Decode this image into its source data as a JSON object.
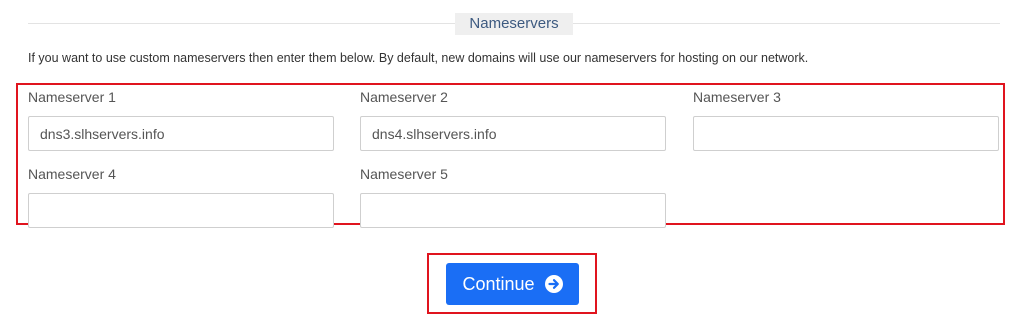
{
  "section": {
    "title": "Nameservers",
    "intro": "If you want to use custom nameservers then enter them below. By default, new domains will use our nameservers for hosting on our network."
  },
  "nameservers": [
    {
      "label": "Nameserver 1",
      "value": "dns3.slhservers.info",
      "placeholder": ""
    },
    {
      "label": "Nameserver 2",
      "value": "dns4.slhservers.info",
      "placeholder": ""
    },
    {
      "label": "Nameserver 3",
      "value": "",
      "placeholder": ""
    },
    {
      "label": "Nameserver 4",
      "value": "",
      "placeholder": ""
    },
    {
      "label": "Nameserver 5",
      "value": "",
      "placeholder": ""
    }
  ],
  "actions": {
    "continue_label": "Continue",
    "continue_icon": "arrow-circle-right-icon"
  },
  "colors": {
    "primary": "#1a6ef5",
    "highlight": "#e0141e"
  }
}
